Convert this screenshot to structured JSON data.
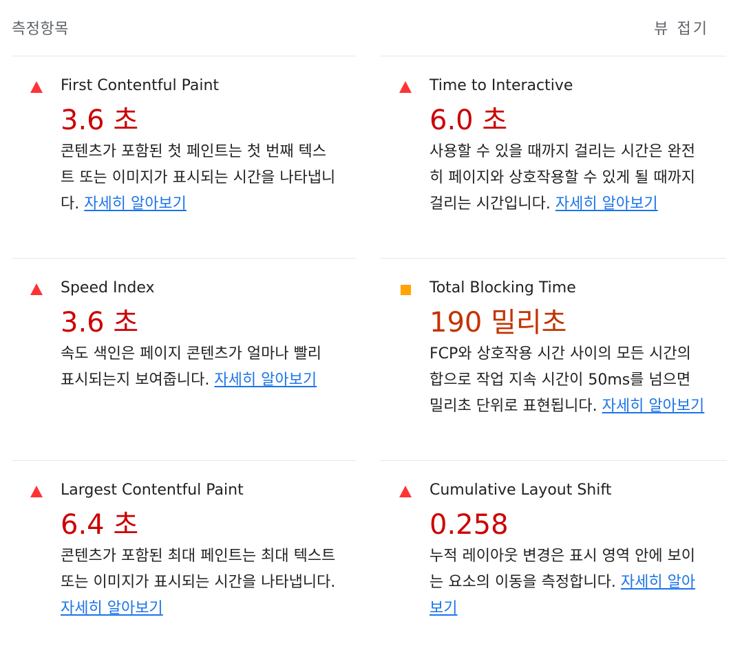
{
  "header": {
    "title": "측정항목",
    "toggle_label": "뷰 접기"
  },
  "colors": {
    "fail": "#cc0000",
    "average": "#c33300",
    "fail_icon": "#ff3333",
    "average_icon": "#ffa400",
    "link": "#1a73e8"
  },
  "metrics": [
    {
      "status": "fail",
      "icon": "red-triangle-icon",
      "title": "First Contentful Paint",
      "value": "3.6 초",
      "description": "콘텐츠가 포함된 첫 페인트는 첫 번째 텍스트 또는 이미지가 표시되는 시간을 나타냅니다.",
      "link": "자세히 알아보기"
    },
    {
      "status": "fail",
      "icon": "red-triangle-icon",
      "title": "Time to Interactive",
      "value": "6.0 초",
      "description": "사용할 수 있을 때까지 걸리는 시간은 완전히 페이지와 상호작용할 수 있게 될 때까지 걸리는 시간입니다.",
      "link": "자세히 알아보기"
    },
    {
      "status": "fail",
      "icon": "red-triangle-icon",
      "title": "Speed Index",
      "value": "3.6 초",
      "description": "속도 색인은 페이지 콘텐츠가 얼마나 빨리 표시되는지 보여줍니다.",
      "link": "자세히 알아보기"
    },
    {
      "status": "average",
      "icon": "orange-square-icon",
      "title": "Total Blocking Time",
      "value": "190 밀리초",
      "description": "FCP와 상호작용 시간 사이의 모든 시간의 합으로 작업 지속 시간이 50ms를 넘으면 밀리초 단위로 표현됩니다.",
      "link": "자세히 알아보기"
    },
    {
      "status": "fail",
      "icon": "red-triangle-icon",
      "title": "Largest Contentful Paint",
      "value": "6.4 초",
      "description": "콘텐츠가 포함된 최대 페인트는 최대 텍스트 또는 이미지가 표시되는 시간을 나타냅니다.",
      "link": "자세히 알아보기"
    },
    {
      "status": "fail",
      "icon": "red-triangle-icon",
      "title": "Cumulative Layout Shift",
      "value": "0.258",
      "description": "누적 레이아웃 변경은 표시 영역 안에 보이는 요소의 이동을 측정합니다.",
      "link": "자세히 알아보기"
    }
  ]
}
